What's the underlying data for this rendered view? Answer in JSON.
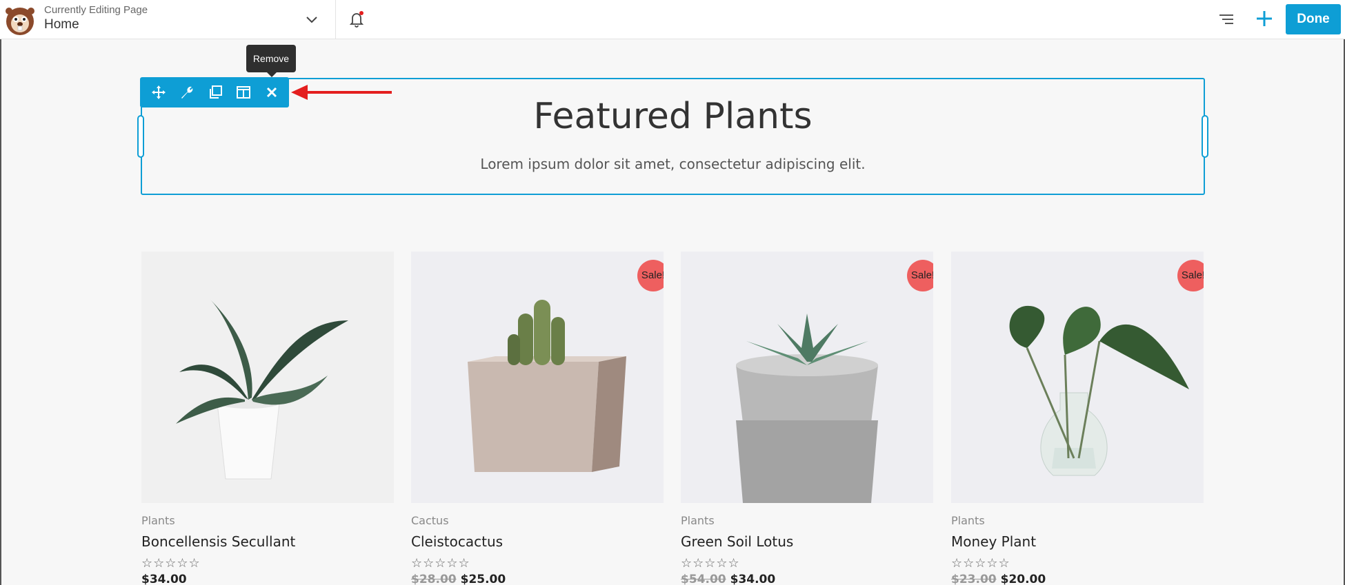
{
  "header": {
    "label": "Currently Editing Page",
    "page_title": "Home",
    "done_label": "Done"
  },
  "tooltip": {
    "text": "Remove"
  },
  "module": {
    "heading": "Featured Plants",
    "subheading": "Lorem ipsum dolor sit amet, consectetur adipiscing elit."
  },
  "products": [
    {
      "category": "Plants",
      "name": "Boncellensis Secullant",
      "stars": "☆☆☆☆☆",
      "old_price": "",
      "price": "$34.00",
      "sale": ""
    },
    {
      "category": "Cactus",
      "name": "Cleistocactus",
      "stars": "☆☆☆☆☆",
      "old_price": "$28.00",
      "price": "$25.00",
      "sale": "Sale!"
    },
    {
      "category": "Plants",
      "name": "Green Soil Lotus",
      "stars": "☆☆☆☆☆",
      "old_price": "$54.00",
      "price": "$34.00",
      "sale": "Sale!"
    },
    {
      "category": "Plants",
      "name": "Money Plant",
      "stars": "☆☆☆☆☆",
      "old_price": "$23.00",
      "price": "$20.00",
      "sale": "Sale!"
    }
  ],
  "colors": {
    "accent": "#0e9ed5",
    "sale": "#ee5f5f",
    "arrow": "#e41e1e"
  }
}
